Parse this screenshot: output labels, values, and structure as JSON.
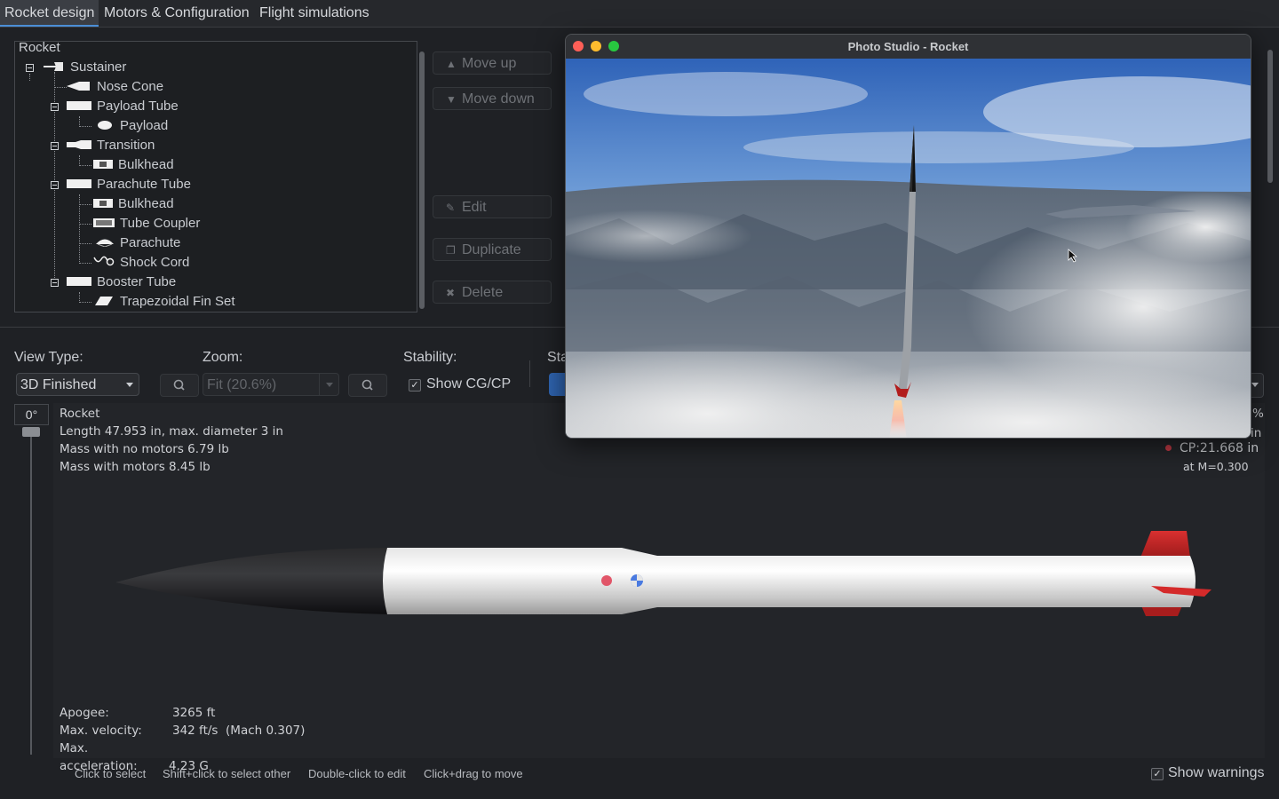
{
  "tabs": [
    "Rocket design",
    "Motors & Configuration",
    "Flight simulations"
  ],
  "tree": {
    "root": "Rocket",
    "items": [
      "Sustainer",
      "Nose Cone",
      "Payload Tube",
      "Payload",
      "Transition",
      "Bulkhead",
      "Parachute Tube",
      "Bulkhead",
      "Tube Coupler",
      "Parachute",
      "Shock Cord",
      "Booster Tube",
      "Trapezoidal Fin Set"
    ]
  },
  "side_buttons": {
    "move_up": "Move up",
    "move_down": "Move down",
    "edit": "Edit",
    "duplicate": "Duplicate",
    "delete": "Delete"
  },
  "controls": {
    "view_type_label": "View Type:",
    "view_type_value": "3D Finished",
    "zoom_label": "Zoom:",
    "zoom_value": "Fit (20.6%)",
    "stability_label": "Stability:",
    "show_cgcp": "Show CG/CP",
    "partial_label": "Sta",
    "angle": "0°"
  },
  "rocket_info": {
    "name": "Rocket",
    "length": "Length 47.953 in, max. diameter 3 in",
    "mass_no_motors": "Mass with no motors 6.79 lb",
    "mass_with_motors": "Mass with motors 8.45 lb"
  },
  "cp_info": {
    "percent": "%",
    "in_unit": "in",
    "cp": "CP:21.668 in",
    "mach": "at M=0.300"
  },
  "flight": {
    "apogee_label": "Apogee:",
    "apogee_value": "3265 ft",
    "velocity_label": "Max. velocity:",
    "velocity_value": "342 ft/s  (Mach 0.307)",
    "accel_label": "Max. acceleration:",
    "accel_value": "4.23 G"
  },
  "status": {
    "hint1": "Click to select",
    "hint2": "Shift+click to select other",
    "hint3": "Double-click to edit",
    "hint4": "Click+drag to move",
    "show_warnings": "Show warnings"
  },
  "photo_studio": {
    "title": "Photo Studio - Rocket"
  },
  "colors": {
    "accent": "#4b8ed6",
    "fin_red": "#d42a2a",
    "cg_blue": "#4a7ae0",
    "cp_red": "#e0455a"
  }
}
